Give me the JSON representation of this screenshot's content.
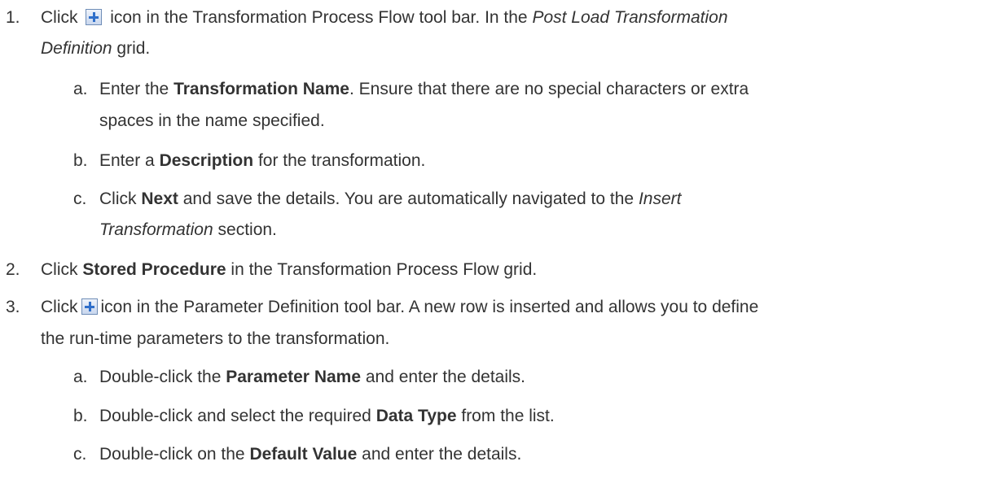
{
  "step1": {
    "number": "1.",
    "line1_a": "Click",
    "line1_b": "icon in the Transformation Process Flow tool bar. In the",
    "line1_c": "Post Load Transformation",
    "line2_a": "Definition",
    "line2_b": "grid.",
    "subs": [
      {
        "letter": "a.",
        "l1_a": "Enter the",
        "l1_b": "Transformation Name",
        "l1_c": ". Ensure that there are no special characters or extra",
        "l2": "spaces in the name specified."
      },
      {
        "letter": "b.",
        "l1_a": "Enter a",
        "l1_b": "Description",
        "l1_c": "for the transformation."
      },
      {
        "letter": "c.",
        "l1_a": "Click",
        "l1_b": "Next",
        "l1_c": "and save the details. You are automatically navigated to the",
        "l1_d": "Insert",
        "l2_a": "Transformation",
        "l2_b": "section."
      }
    ]
  },
  "step2": {
    "number": "2.",
    "a": "Click",
    "b": "Stored Procedure",
    "c": "in the Transformation Process Flow grid."
  },
  "step3": {
    "number": "3.",
    "line1_a": "Click",
    "line1_b": "icon in the Parameter Definition tool bar. A new row is inserted and allows you to define",
    "line2": "the run-time parameters to the transformation.",
    "subs": [
      {
        "letter": "a.",
        "a": "Double-click the",
        "b": "Parameter Name",
        "c": "and enter the details."
      },
      {
        "letter": "b.",
        "a": "Double-click and select the required",
        "b": "Data Type",
        "c": "from the list."
      },
      {
        "letter": "c.",
        "a": "Double-click on the",
        "b": "Default Value",
        "c": "and enter the details."
      }
    ]
  },
  "icons": {
    "add": "add-row-icon"
  }
}
